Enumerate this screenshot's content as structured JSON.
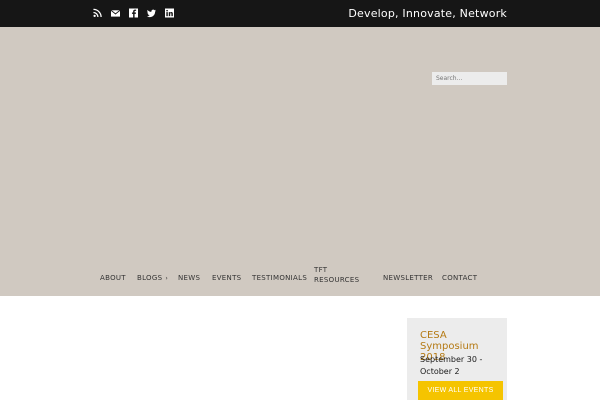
{
  "topbar": {
    "tagline": "Develop, Innovate, Network",
    "social_icons": [
      "rss-icon",
      "email-icon",
      "facebook-icon",
      "twitter-icon",
      "linkedin-icon"
    ]
  },
  "search": {
    "placeholder": "Search..."
  },
  "nav": {
    "items": [
      {
        "label": "ABOUT"
      },
      {
        "label": "BLOGS"
      },
      {
        "label": "NEWS"
      },
      {
        "label": "EVENTS"
      },
      {
        "label": "TESTIMONIALS"
      },
      {
        "label": "TFT RESOURCES"
      },
      {
        "label": "NEWSLETTER"
      },
      {
        "label": "CONTACT"
      }
    ]
  },
  "event": {
    "title": "CESA Symposium 2018",
    "date": "September 30 - October 2",
    "button_label": "VIEW ALL EVENTS"
  },
  "colors": {
    "topbar_bg": "#161616",
    "header_bg": "#d0c9c1",
    "accent_yellow": "#f5c400",
    "event_title": "#b57a14"
  }
}
